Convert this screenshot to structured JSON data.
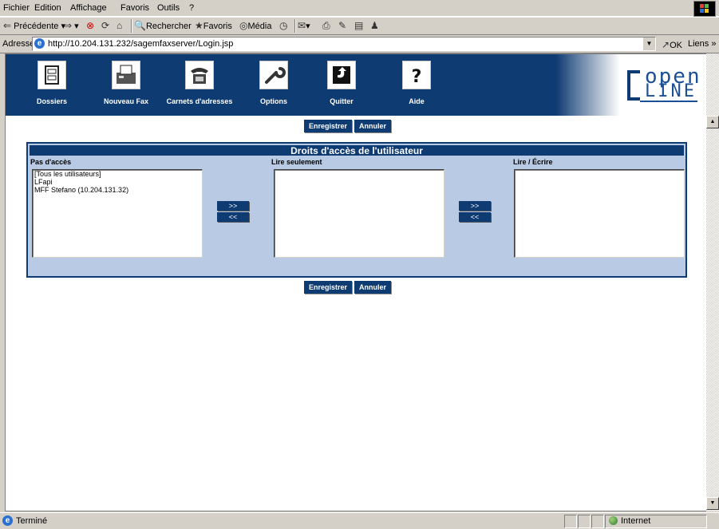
{
  "browser": {
    "menu": [
      "Fichier",
      "Edition",
      "Affichage",
      "Favoris",
      "Outils",
      "?"
    ],
    "toolbar": {
      "back": "Précédente",
      "search": "Rechercher",
      "favorites": "Favoris",
      "media": "Média"
    },
    "address": {
      "label": "Adresse",
      "url": "http://10.204.131.232/sagemfaxserver/Login.jsp",
      "go": "OK",
      "links": "Liens"
    },
    "status": {
      "text": "Terminé",
      "zone": "Internet"
    }
  },
  "nav": {
    "items": [
      {
        "label": "Dossiers",
        "icon": "folders-icon"
      },
      {
        "label": "Nouveau Fax",
        "icon": "new-fax-icon"
      },
      {
        "label": "Carnets d'adresses",
        "icon": "phone-icon"
      },
      {
        "label": "Options",
        "icon": "wrench-icon"
      },
      {
        "label": "Quitter",
        "icon": "exit-icon"
      },
      {
        "label": "Aide",
        "icon": "help-icon"
      }
    ],
    "logo_line1": "open",
    "logo_line2": "LINE"
  },
  "actions": {
    "save": "Enregistrer",
    "cancel": "Annuler"
  },
  "panel": {
    "title": "Droits d'accès de l'utilisateur",
    "col_no_access": "Pas d'accès",
    "col_read_only": "Lire seulement",
    "col_read_write": "Lire / Écrire",
    "no_access_items": [
      "[Tous les utilisateurs]",
      "LFapi",
      "MFF Stefano (10.204.131.32)"
    ],
    "read_only_items": [],
    "read_write_items": [],
    "move_right": ">>",
    "move_left": "<<"
  },
  "colors": {
    "brand": "#0f3b73",
    "panel_bg": "#b9cbe4",
    "chrome": "#d4d0c8"
  }
}
